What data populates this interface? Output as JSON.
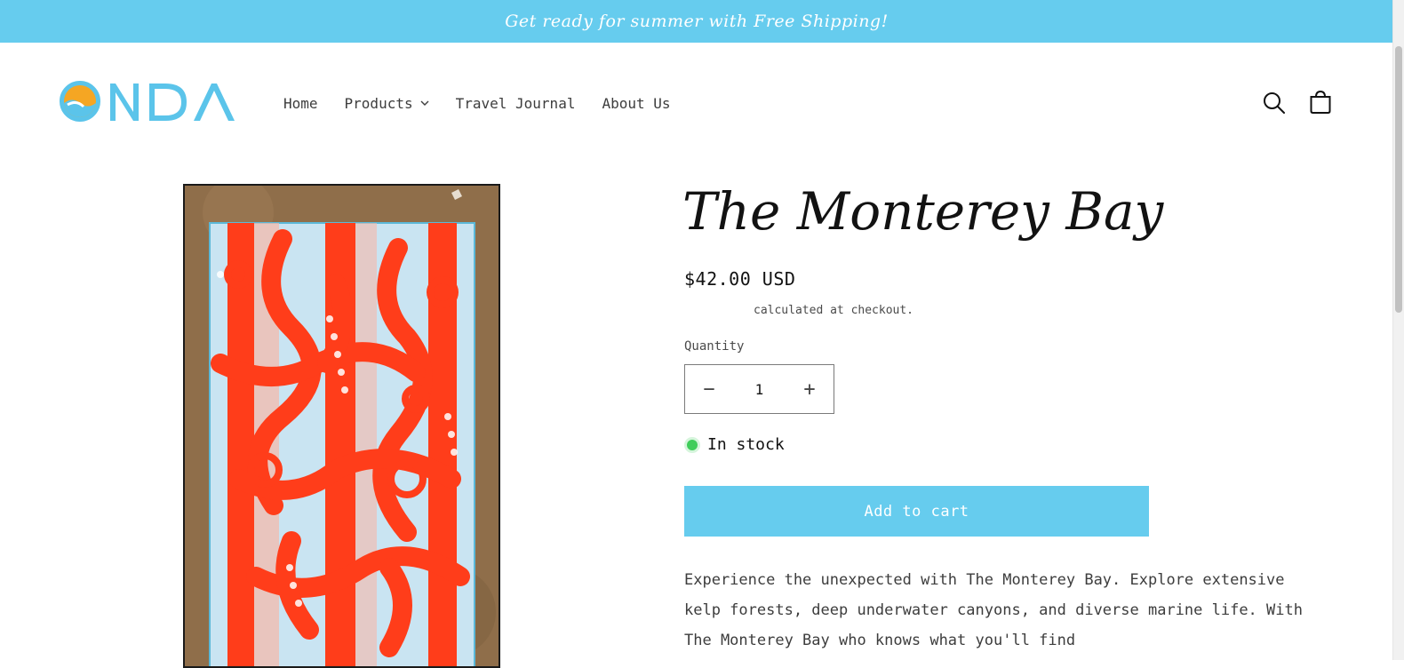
{
  "announcement": "Get ready for summer with Free Shipping!",
  "brand": {
    "logo_text": "ONDA",
    "logo_color": "#5bc4ea",
    "sun_color": "#f5a623"
  },
  "nav": {
    "items": [
      {
        "label": "Home"
      },
      {
        "label": "Products"
      },
      {
        "label": "Travel Journal"
      },
      {
        "label": "About Us"
      }
    ]
  },
  "header_icons": [
    "search-icon",
    "cart-icon"
  ],
  "product": {
    "title": "The Monterey Bay",
    "price": "$42.00 USD",
    "tax_note": "calculated at checkout.",
    "quantity_label": "Quantity",
    "quantity_value": "1",
    "decrease_symbol": "−",
    "increase_symbol": "+",
    "stock_status": "In stock",
    "add_to_cart_label": "Add to cart",
    "description": "Experience the unexpected with The Monterey Bay. Explore extensive kelp forests, deep underwater canyons, and diverse marine life. With The Monterey Bay who knows what you'll find"
  },
  "colors": {
    "accent": "#66ccee",
    "in_stock": "#3fcd5a",
    "towel_orange": "#ff3d1a",
    "towel_blue": "#c9e4f2",
    "sand": "#8f6e4a"
  }
}
